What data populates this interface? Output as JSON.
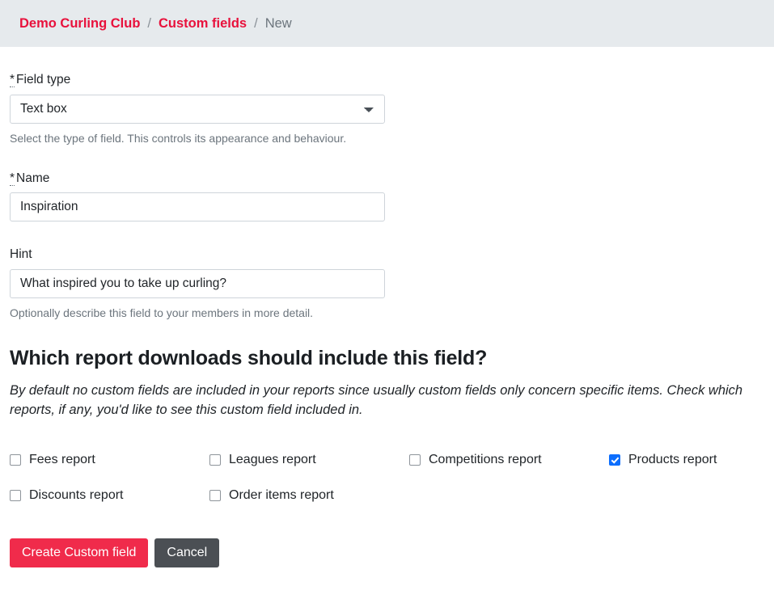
{
  "breadcrumb": {
    "items": [
      {
        "label": "Demo Curling Club",
        "type": "link"
      },
      {
        "label": "Custom fields",
        "type": "link"
      },
      {
        "label": "New",
        "type": "current"
      }
    ],
    "separator": "/"
  },
  "form": {
    "field_type": {
      "required_marker": "*",
      "label": "Field type",
      "value": "Text box",
      "options": [
        "Text box"
      ],
      "help": "Select the type of field. This controls its appearance and behaviour.",
      "dropdown_icon": "chevron-down-icon"
    },
    "name": {
      "required_marker": "*",
      "label": "Name",
      "value": "Inspiration",
      "placeholder": ""
    },
    "hint": {
      "label": "Hint",
      "value": "What inspired you to take up curling?",
      "placeholder": "",
      "help": "Optionally describe this field to your members in more detail."
    }
  },
  "reports": {
    "heading": "Which report downloads should include this field?",
    "description": "By default no custom fields are included in your reports since usually custom fields only concern specific items. Check which reports, if any, you'd like to see this custom field included in.",
    "checkboxes": [
      {
        "label": "Fees report",
        "checked": false
      },
      {
        "label": "Leagues report",
        "checked": false
      },
      {
        "label": "Competitions report",
        "checked": false
      },
      {
        "label": "Products report",
        "checked": true
      },
      {
        "label": "Discounts report",
        "checked": false
      },
      {
        "label": "Order items report",
        "checked": false
      }
    ]
  },
  "actions": {
    "submit_label": "Create Custom field",
    "cancel_label": "Cancel"
  },
  "colors": {
    "breadcrumb_bg": "#e6eaed",
    "link": "#e8113c",
    "primary_button": "#f02b4b",
    "secondary_button": "#4b4f54",
    "checkbox_checked": "#0d6efd",
    "help_text": "#6c757d"
  }
}
